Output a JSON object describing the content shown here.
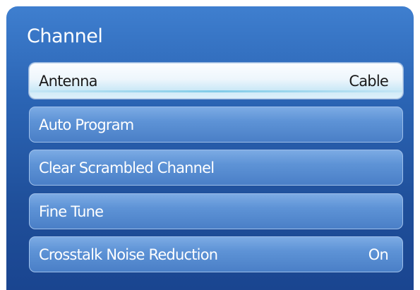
{
  "panel": {
    "title": "Channel"
  },
  "menu": {
    "items": [
      {
        "label": "Antenna",
        "value": "Cable",
        "selected": true
      },
      {
        "label": "Auto Program",
        "value": ""
      },
      {
        "label": "Clear Scrambled Channel",
        "value": ""
      },
      {
        "label": "Fine Tune",
        "value": ""
      },
      {
        "label": "Crosstalk Noise Reduction",
        "value": "On"
      }
    ]
  },
  "colors": {
    "panel_top": "#3f7fcf",
    "panel_bottom": "#1a4590",
    "item_bg": "#5e93d6",
    "item_border": "#9fc0ea",
    "selected_bg": "#eef6fc",
    "selected_text": "#1a1a1a",
    "text": "#ffffff"
  }
}
